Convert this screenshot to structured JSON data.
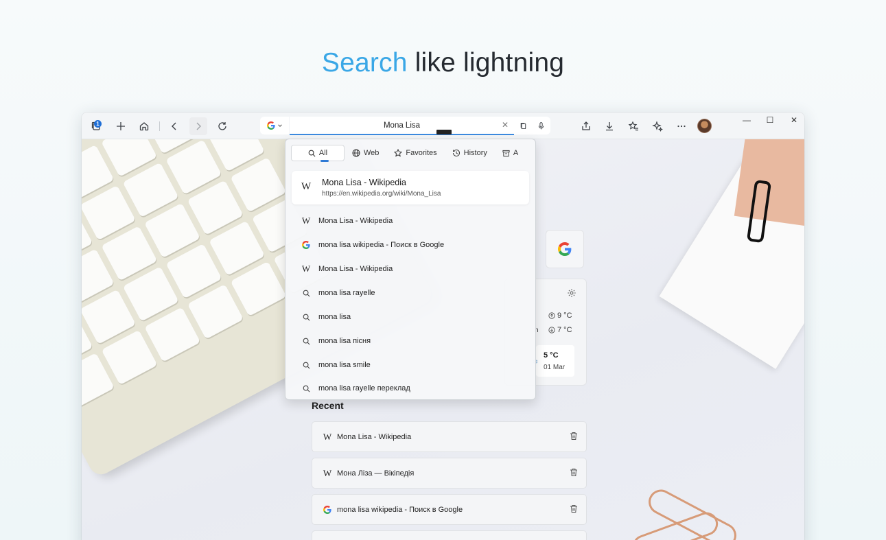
{
  "headline": {
    "accent": "Search",
    "rest": " like lightning"
  },
  "toolbar": {
    "tabs_badge": "1",
    "address_value": "Mona Lisa",
    "clear_glyph": "✕"
  },
  "dropdown": {
    "tabs": [
      {
        "label": "All",
        "icon": "search-icon"
      },
      {
        "label": "Web",
        "icon": "globe-icon"
      },
      {
        "label": "Favorites",
        "icon": "star-icon"
      },
      {
        "label": "History",
        "icon": "history-icon"
      },
      {
        "label": "A",
        "icon": "archive-icon"
      }
    ],
    "top_result": {
      "icon": "W",
      "title": "Mona Lisa - Wikipedia",
      "url": "https://en.wikipedia.org/wiki/Mona_Lisa"
    },
    "suggestions": [
      {
        "icon": "wikipedia-icon",
        "text": "Mona Lisa - Wikipedia"
      },
      {
        "icon": "google-icon",
        "text": "mona lisa wikipedia - Поиск в Google"
      },
      {
        "icon": "wikipedia-icon",
        "text": "Mona Lisa - Wikipedia"
      },
      {
        "icon": "search-icon",
        "text": "mona lisa rayelle"
      },
      {
        "icon": "search-icon",
        "text": "mona lisa"
      },
      {
        "icon": "search-icon",
        "text": "mona lisa пісня"
      },
      {
        "icon": "search-icon",
        "text": "mona lisa smile"
      },
      {
        "icon": "search-icon",
        "text": "mona lisa rayelle переклад"
      }
    ]
  },
  "weather": {
    "high": "9 °C",
    "low": "7 °C",
    "partial_label": "n",
    "forecast_temp": "5 °C",
    "forecast_date": "01 Mar"
  },
  "recent": {
    "title": "Recent",
    "items": [
      {
        "icon": "wikipedia-icon",
        "text": "Mona Lisa - Wikipedia"
      },
      {
        "icon": "wikipedia-icon",
        "text": "Мона Ліза — Вікіпедія"
      },
      {
        "icon": "google-icon",
        "text": "mona lisa wikipedia - Поиск в Google"
      }
    ]
  },
  "colors": {
    "accent": "#3aa7e6",
    "address_focus": "#3c8be0",
    "badge": "#1f6fd6"
  }
}
